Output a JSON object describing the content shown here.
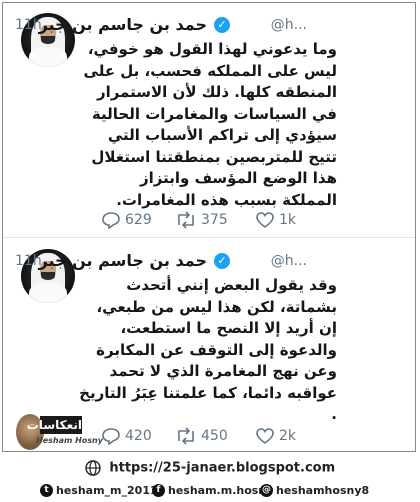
{
  "tweets": [
    {
      "author_name": "حمد بن جاسم بن جبر",
      "handle": "@h...",
      "time": "11h",
      "text_lines": [
        "وما يدعوني لهذا القول هو خوفي،",
        "ليس على المملكه فحسب، بل على",
        "المنطقه كلها. ذلك لأن الاستمرار",
        "في السياسات والمغامرات الحالية",
        "سيؤدي إلى تراكم الأسباب التي",
        "تتيح للمتربصين بمنطقتنا استغلال",
        "هذا الوضع المؤسف وابتزاز",
        "المملكة بسبب هذه المغامرات."
      ],
      "replies": "629",
      "retweets": "375",
      "likes": "1k"
    },
    {
      "author_name": "حمد بن جاسم بن جبر",
      "handle": "@h...",
      "time": "11h",
      "text_lines": [
        "وقد يقول البعض إنني أتحدث",
        "بشماتة، لكن هذا ليس من طبعي،",
        "إن أريد إلا النصح ما استطعت،",
        "والدعوة إلى التوقف عن المكابرة",
        "وعن نهج المغامرة الذي لا تحمد",
        "عواقبه دائما، كما علمتنا عِبَرُ التاريخ",
        "."
      ],
      "replies": "420",
      "retweets": "450",
      "likes": "2k"
    }
  ],
  "watermark": {
    "title": "انعكاسات",
    "name": "Hesham Hosny"
  },
  "footer": {
    "url": "https://25-janaer.blogspot.com",
    "social": [
      {
        "icon": "twitter-icon",
        "glyph": "t",
        "label": "hesham_m_2011"
      },
      {
        "icon": "facebook-icon",
        "glyph": "f",
        "label": "hesham.m.hosny"
      },
      {
        "icon": "threads-icon",
        "glyph": "@",
        "label": "heshamhosny8"
      }
    ]
  },
  "colors": {
    "verified": "#1da1f2",
    "meta_text": "#657786",
    "body_text": "#14171a"
  }
}
